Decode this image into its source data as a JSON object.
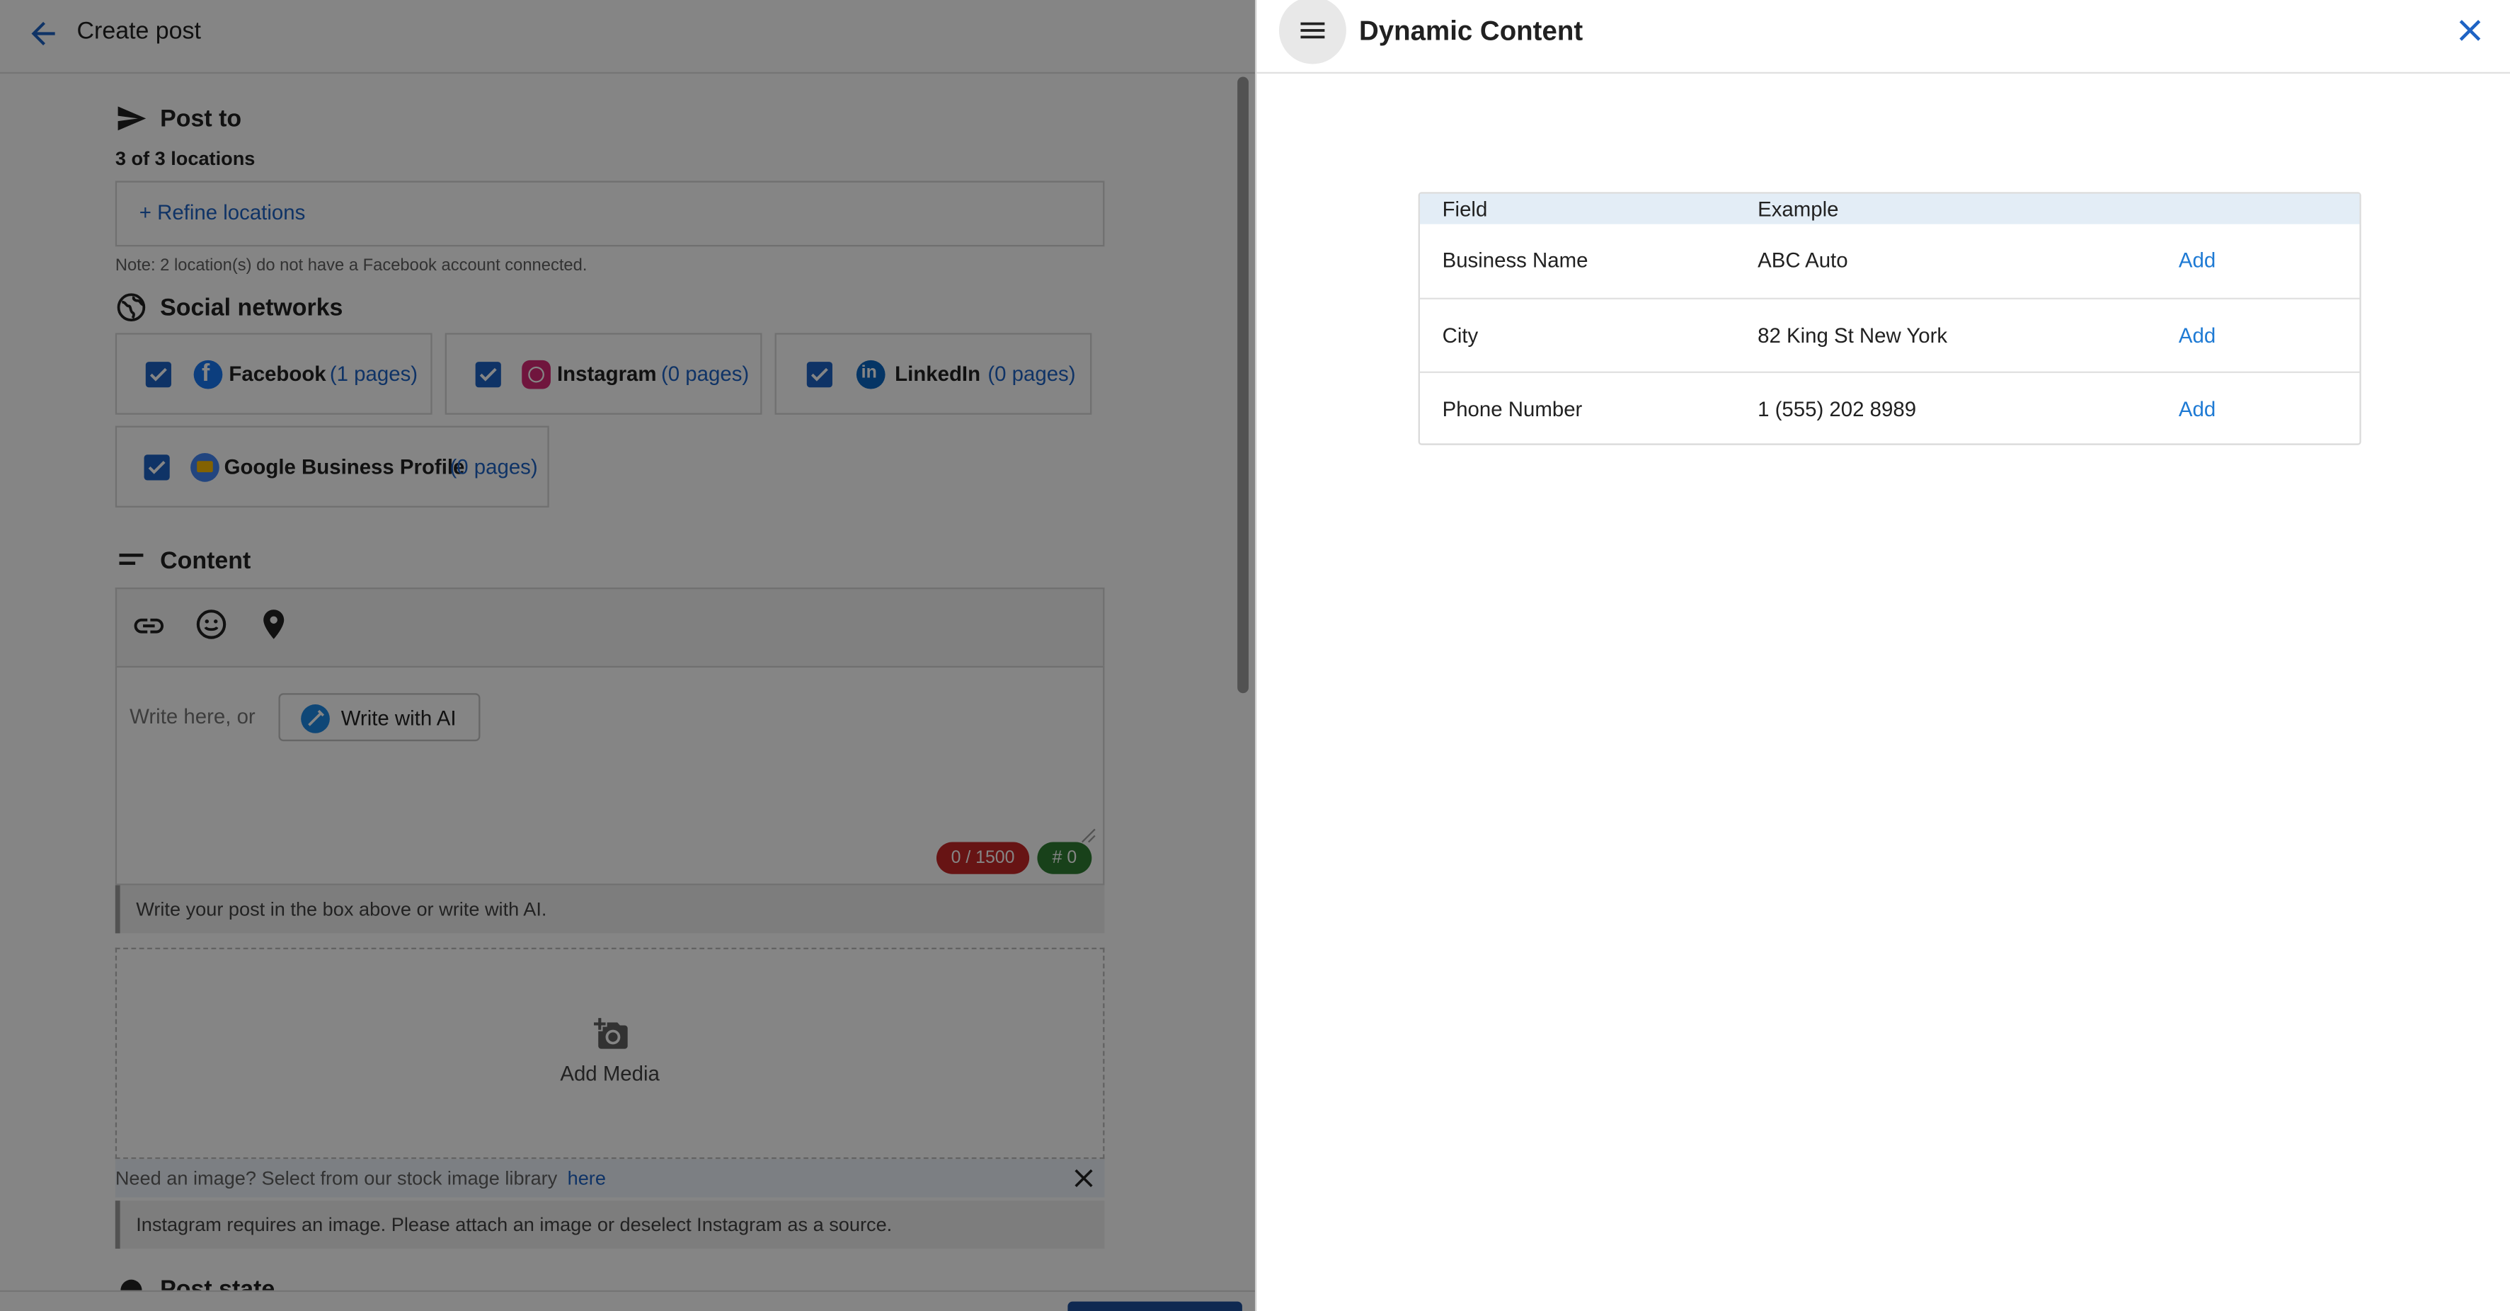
{
  "left_panel": {
    "header": {
      "title": "Create post"
    },
    "post_to": {
      "title": "Post to",
      "locations_count": "3 of 3 locations",
      "refine_label": "+ Refine locations",
      "note": "Note: 2 location(s) do not have a Facebook account connected."
    },
    "social": {
      "title": "Social networks",
      "networks": [
        {
          "name": "Facebook",
          "pages": "(1 pages)",
          "checked": true
        },
        {
          "name": "Instagram",
          "pages": "(0 pages)",
          "checked": true
        },
        {
          "name": "LinkedIn",
          "pages": "(0 pages)",
          "checked": true
        },
        {
          "name": "Google Business Profile",
          "pages": "(0 pages)",
          "checked": true
        }
      ]
    },
    "content": {
      "title": "Content",
      "toolbar_icons": [
        "link-icon",
        "emoji-icon",
        "location-pin-icon"
      ],
      "placeholder": "Write here, or",
      "ai_button": "Write with AI",
      "char_count": "0 / 1500",
      "hashtag_count": "# 0",
      "hint": "Write your post in the box above or write with AI."
    },
    "media": {
      "add_label": "Add Media",
      "stock_text": "Need an image? Select from our stock image library",
      "stock_link": "here",
      "instagram_warning": "Instagram requires an image. Please attach an image or deselect Instagram as a source."
    },
    "post_state": {
      "title": "Post state"
    }
  },
  "dynamic_panel": {
    "title": "Dynamic Content",
    "columns": [
      "Field",
      "Example"
    ],
    "rows": [
      {
        "field": "Business Name",
        "example": "ABC Auto",
        "action": "Add"
      },
      {
        "field": "City",
        "example": "82 King St New York",
        "action": "Add"
      },
      {
        "field": "Phone Number",
        "example": "1 (555) 202 8989",
        "action": "Add"
      }
    ]
  },
  "colors": {
    "accent": "#1e63c4",
    "add_link": "#1e7ad4",
    "char_count_pill": "#c62828",
    "hashtag_pill": "#2e7d32",
    "table_header": "#e3edf6"
  }
}
